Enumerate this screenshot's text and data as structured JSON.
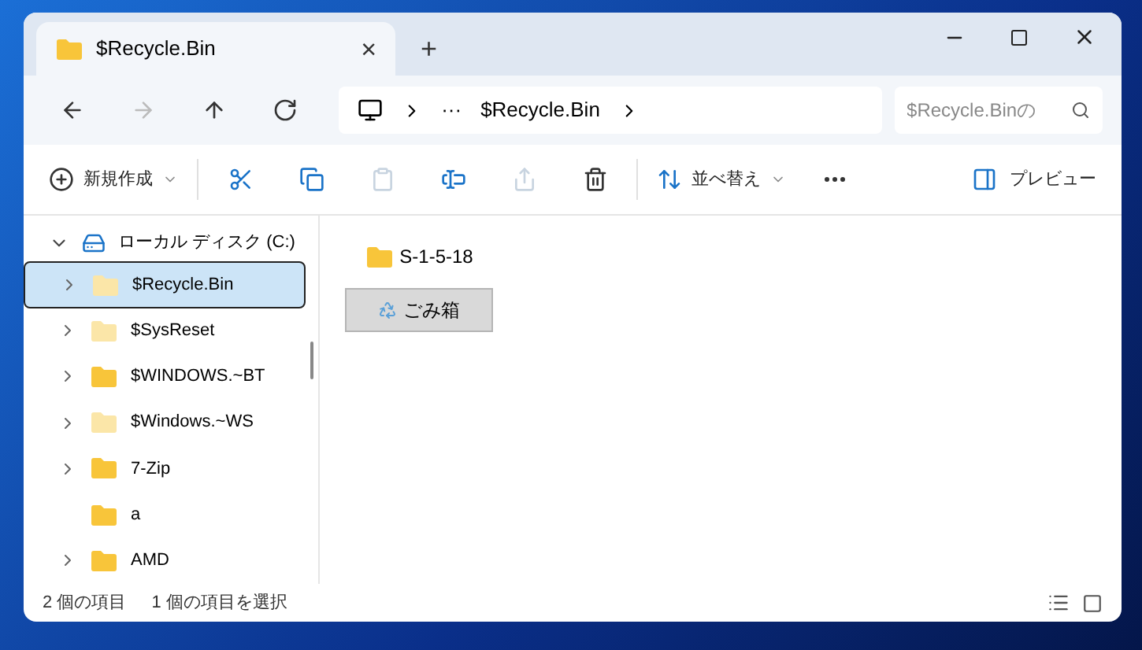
{
  "tab": {
    "title": "$Recycle.Bin",
    "close": "×",
    "new_tab": "+"
  },
  "nav": [
    {
      "kind": "back",
      "disabled": false
    },
    {
      "kind": "forward",
      "disabled": true
    },
    {
      "kind": "up",
      "disabled": false
    },
    {
      "kind": "refresh",
      "disabled": false
    }
  ],
  "address": {
    "ellipsis": "···",
    "segment": "$Recycle.Bin"
  },
  "search": {
    "placeholder": "$Recycle.Binの"
  },
  "toolbar": [
    {
      "kind": "new",
      "label": "新規作成",
      "disabled": false
    },
    {
      "kind": "cut",
      "disabled": false
    },
    {
      "kind": "copy",
      "disabled": false
    },
    {
      "kind": "paste",
      "disabled": true
    },
    {
      "kind": "rename",
      "disabled": false
    },
    {
      "kind": "share",
      "disabled": true
    },
    {
      "kind": "delete",
      "disabled": false
    },
    {
      "kind": "sort",
      "label": "並べ替え",
      "disabled": false
    },
    {
      "kind": "more",
      "disabled": false
    }
  ],
  "preview": {
    "label": "プレビュー"
  },
  "sidebar": {
    "items": [
      {
        "kind": "drive",
        "label": "ローカル ディスク (C:)",
        "expanded": true,
        "selected": false,
        "children": [
          {
            "kind": "folder",
            "label": "$Recycle.Bin",
            "expandable": true,
            "hidden": true,
            "selected": true
          },
          {
            "kind": "folder",
            "label": "$SysReset",
            "expandable": true,
            "hidden": true,
            "selected": false
          },
          {
            "kind": "folder",
            "label": "$WINDOWS.~BT",
            "expandable": true,
            "hidden": false,
            "selected": false
          },
          {
            "kind": "folder",
            "label": "$Windows.~WS",
            "expandable": true,
            "hidden": true,
            "selected": false
          },
          {
            "kind": "folder",
            "label": "7-Zip",
            "expandable": true,
            "hidden": false,
            "selected": false
          },
          {
            "kind": "folder",
            "label": "a",
            "expandable": false,
            "hidden": false,
            "selected": false
          },
          {
            "kind": "folder",
            "label": "AMD",
            "expandable": true,
            "hidden": false,
            "selected": false
          }
        ]
      }
    ]
  },
  "files": [
    {
      "kind": "folder",
      "label": "S-1-5-18",
      "selected": false
    },
    {
      "kind": "recycle",
      "label": "ごみ箱",
      "selected": true
    }
  ],
  "status_bar": {
    "count": "2 個の項目",
    "selection": "1 個の項目を選択"
  }
}
